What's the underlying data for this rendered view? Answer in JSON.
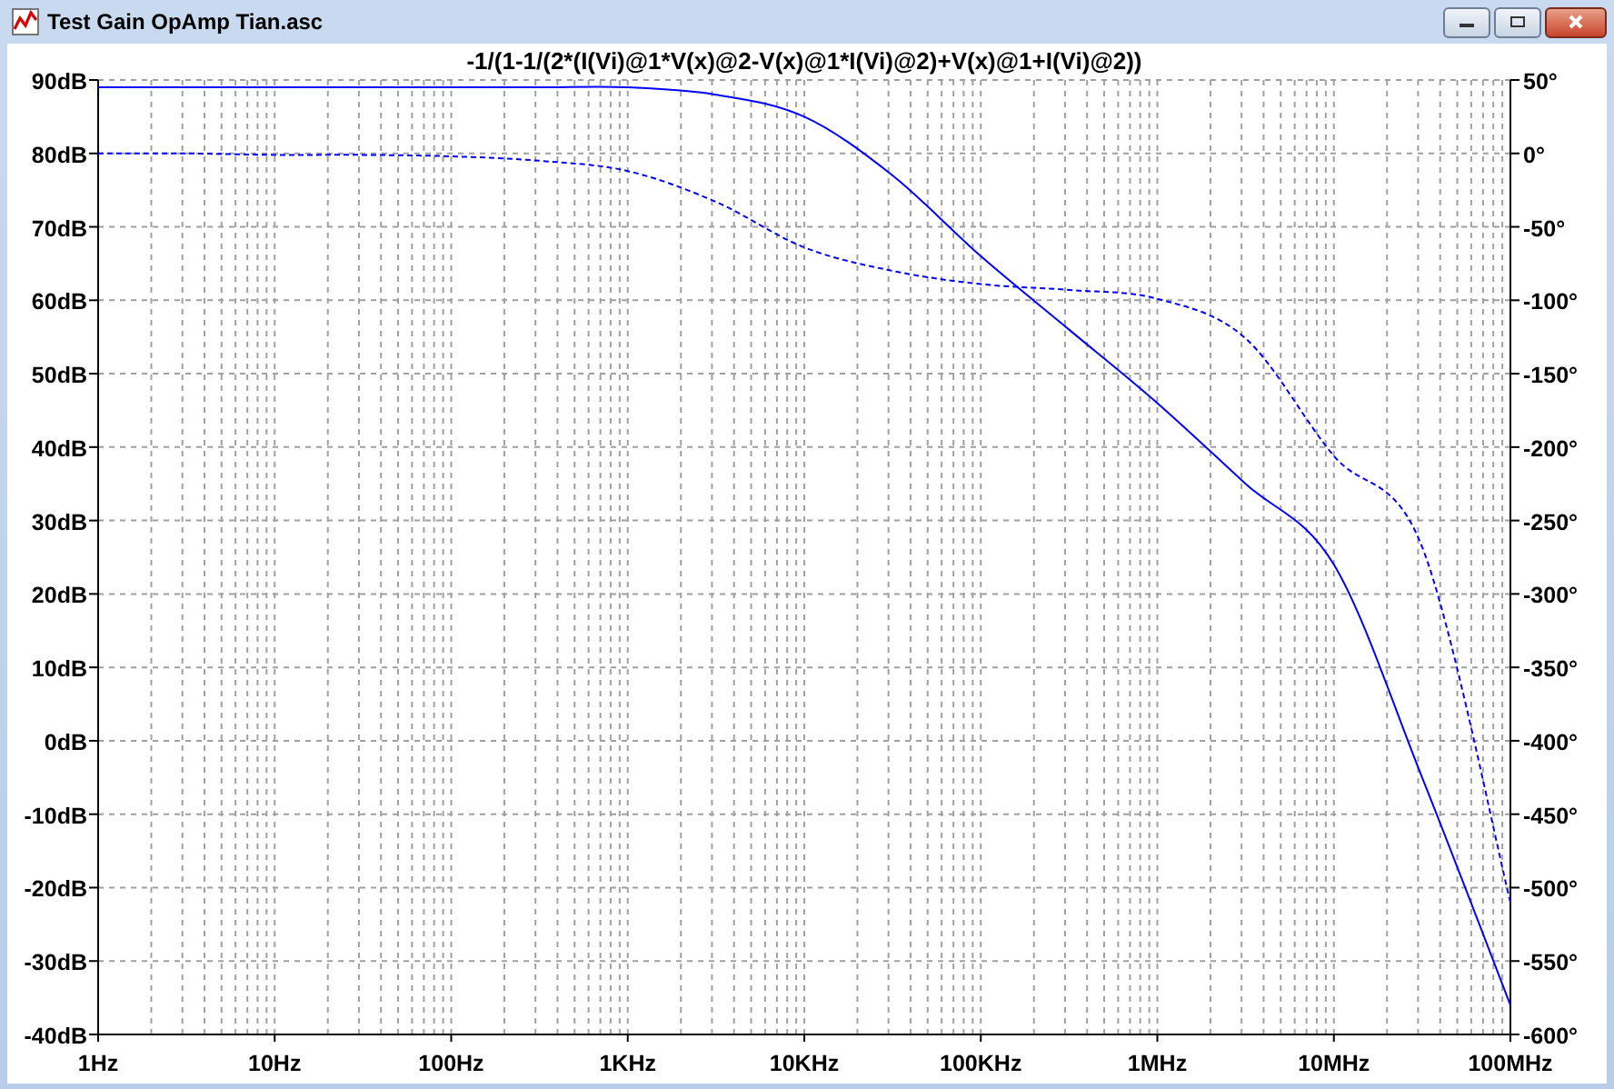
{
  "window": {
    "title": "Test Gain OpAmp Tian.asc"
  },
  "plot": {
    "chart_data": {
      "type": "line",
      "title": "-1/(1-1/(2*(I(Vi)@1*V(x)@2-V(x)@1*I(Vi)@2)+V(x)@1+I(Vi)@2))",
      "categories": [
        "1Hz",
        null,
        "10Hz",
        null,
        "100Hz",
        null,
        "1KHz",
        null,
        "10KHz",
        null,
        "100KHz",
        null,
        "1MHz",
        null,
        "10MHz",
        null,
        "100MHz"
      ],
      "series": [
        {
          "color": "#0000ff",
          "line_style": "solid",
          "values": [
            89,
            89,
            89,
            89,
            89,
            89,
            89,
            88,
            85,
            77,
            66,
            56,
            46,
            35,
            24,
            -5,
            -36
          ]
        },
        {
          "color": "#0000ff",
          "axis": "y2",
          "line_style": "dashed",
          "values": [
            0,
            0,
            -1,
            -1,
            -2,
            -5,
            -12,
            -33,
            -64,
            -80,
            -89,
            -93,
            -99,
            -126,
            -206,
            -268,
            -510
          ]
        }
      ],
      "grid": true,
      "ylim": [
        -40,
        90
      ],
      "yticks": [
        {
          "value": 90,
          "label": "90dB"
        },
        {
          "value": 80,
          "label": "80dB"
        },
        {
          "value": 70,
          "label": "70dB"
        },
        {
          "value": 60,
          "label": "60dB"
        },
        {
          "value": 50,
          "label": "50dB"
        },
        {
          "value": 40,
          "label": "40dB"
        },
        {
          "value": 30,
          "label": "30dB"
        },
        {
          "value": 20,
          "label": "20dB"
        },
        {
          "value": 10,
          "label": "10dB"
        },
        {
          "value": 0,
          "label": "0dB"
        },
        {
          "value": -10,
          "label": "-10dB"
        },
        {
          "value": -20,
          "label": "-20dB"
        },
        {
          "value": -30,
          "label": "-30dB"
        },
        {
          "value": -40,
          "label": "-40dB"
        }
      ],
      "y2lim": [
        -600,
        50
      ],
      "y2ticks": [
        {
          "value": 50,
          "label": "50°"
        },
        {
          "value": 0,
          "label": "0°"
        },
        {
          "value": -50,
          "label": "-50°"
        },
        {
          "value": -100,
          "label": "-100°"
        },
        {
          "value": -150,
          "label": "-150°"
        },
        {
          "value": -200,
          "label": "-200°"
        },
        {
          "value": -250,
          "label": "-250°"
        },
        {
          "value": -300,
          "label": "-300°"
        },
        {
          "value": -350,
          "label": "-350°"
        },
        {
          "value": -400,
          "label": "-400°"
        },
        {
          "value": -450,
          "label": "-450°"
        },
        {
          "value": -500,
          "label": "-500°"
        },
        {
          "value": -550,
          "label": "-550°"
        },
        {
          "value": -600,
          "label": "-600°"
        }
      ]
    }
  }
}
